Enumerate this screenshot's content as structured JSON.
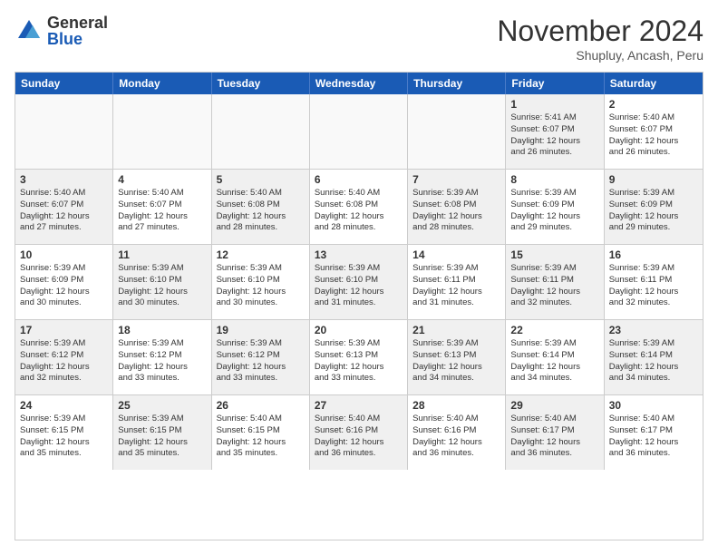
{
  "logo": {
    "general": "General",
    "blue": "Blue"
  },
  "title": "November 2024",
  "location": "Shupluy, Ancash, Peru",
  "days_of_week": [
    "Sunday",
    "Monday",
    "Tuesday",
    "Wednesday",
    "Thursday",
    "Friday",
    "Saturday"
  ],
  "rows": [
    {
      "cells": [
        {
          "day": "",
          "info": "",
          "empty": true
        },
        {
          "day": "",
          "info": "",
          "empty": true
        },
        {
          "day": "",
          "info": "",
          "empty": true
        },
        {
          "day": "",
          "info": "",
          "empty": true
        },
        {
          "day": "",
          "info": "",
          "empty": true
        },
        {
          "day": "1",
          "info": "Sunrise: 5:41 AM\nSunset: 6:07 PM\nDaylight: 12 hours\nand 26 minutes.",
          "shaded": true
        },
        {
          "day": "2",
          "info": "Sunrise: 5:40 AM\nSunset: 6:07 PM\nDaylight: 12 hours\nand 26 minutes.",
          "shaded": false
        }
      ]
    },
    {
      "cells": [
        {
          "day": "3",
          "info": "Sunrise: 5:40 AM\nSunset: 6:07 PM\nDaylight: 12 hours\nand 27 minutes.",
          "shaded": true
        },
        {
          "day": "4",
          "info": "Sunrise: 5:40 AM\nSunset: 6:07 PM\nDaylight: 12 hours\nand 27 minutes.",
          "shaded": false
        },
        {
          "day": "5",
          "info": "Sunrise: 5:40 AM\nSunset: 6:08 PM\nDaylight: 12 hours\nand 28 minutes.",
          "shaded": true
        },
        {
          "day": "6",
          "info": "Sunrise: 5:40 AM\nSunset: 6:08 PM\nDaylight: 12 hours\nand 28 minutes.",
          "shaded": false
        },
        {
          "day": "7",
          "info": "Sunrise: 5:39 AM\nSunset: 6:08 PM\nDaylight: 12 hours\nand 28 minutes.",
          "shaded": true
        },
        {
          "day": "8",
          "info": "Sunrise: 5:39 AM\nSunset: 6:09 PM\nDaylight: 12 hours\nand 29 minutes.",
          "shaded": false
        },
        {
          "day": "9",
          "info": "Sunrise: 5:39 AM\nSunset: 6:09 PM\nDaylight: 12 hours\nand 29 minutes.",
          "shaded": true
        }
      ]
    },
    {
      "cells": [
        {
          "day": "10",
          "info": "Sunrise: 5:39 AM\nSunset: 6:09 PM\nDaylight: 12 hours\nand 30 minutes.",
          "shaded": false
        },
        {
          "day": "11",
          "info": "Sunrise: 5:39 AM\nSunset: 6:10 PM\nDaylight: 12 hours\nand 30 minutes.",
          "shaded": true
        },
        {
          "day": "12",
          "info": "Sunrise: 5:39 AM\nSunset: 6:10 PM\nDaylight: 12 hours\nand 30 minutes.",
          "shaded": false
        },
        {
          "day": "13",
          "info": "Sunrise: 5:39 AM\nSunset: 6:10 PM\nDaylight: 12 hours\nand 31 minutes.",
          "shaded": true
        },
        {
          "day": "14",
          "info": "Sunrise: 5:39 AM\nSunset: 6:11 PM\nDaylight: 12 hours\nand 31 minutes.",
          "shaded": false
        },
        {
          "day": "15",
          "info": "Sunrise: 5:39 AM\nSunset: 6:11 PM\nDaylight: 12 hours\nand 32 minutes.",
          "shaded": true
        },
        {
          "day": "16",
          "info": "Sunrise: 5:39 AM\nSunset: 6:11 PM\nDaylight: 12 hours\nand 32 minutes.",
          "shaded": false
        }
      ]
    },
    {
      "cells": [
        {
          "day": "17",
          "info": "Sunrise: 5:39 AM\nSunset: 6:12 PM\nDaylight: 12 hours\nand 32 minutes.",
          "shaded": true
        },
        {
          "day": "18",
          "info": "Sunrise: 5:39 AM\nSunset: 6:12 PM\nDaylight: 12 hours\nand 33 minutes.",
          "shaded": false
        },
        {
          "day": "19",
          "info": "Sunrise: 5:39 AM\nSunset: 6:12 PM\nDaylight: 12 hours\nand 33 minutes.",
          "shaded": true
        },
        {
          "day": "20",
          "info": "Sunrise: 5:39 AM\nSunset: 6:13 PM\nDaylight: 12 hours\nand 33 minutes.",
          "shaded": false
        },
        {
          "day": "21",
          "info": "Sunrise: 5:39 AM\nSunset: 6:13 PM\nDaylight: 12 hours\nand 34 minutes.",
          "shaded": true
        },
        {
          "day": "22",
          "info": "Sunrise: 5:39 AM\nSunset: 6:14 PM\nDaylight: 12 hours\nand 34 minutes.",
          "shaded": false
        },
        {
          "day": "23",
          "info": "Sunrise: 5:39 AM\nSunset: 6:14 PM\nDaylight: 12 hours\nand 34 minutes.",
          "shaded": true
        }
      ]
    },
    {
      "cells": [
        {
          "day": "24",
          "info": "Sunrise: 5:39 AM\nSunset: 6:15 PM\nDaylight: 12 hours\nand 35 minutes.",
          "shaded": false
        },
        {
          "day": "25",
          "info": "Sunrise: 5:39 AM\nSunset: 6:15 PM\nDaylight: 12 hours\nand 35 minutes.",
          "shaded": true
        },
        {
          "day": "26",
          "info": "Sunrise: 5:40 AM\nSunset: 6:15 PM\nDaylight: 12 hours\nand 35 minutes.",
          "shaded": false
        },
        {
          "day": "27",
          "info": "Sunrise: 5:40 AM\nSunset: 6:16 PM\nDaylight: 12 hours\nand 36 minutes.",
          "shaded": true
        },
        {
          "day": "28",
          "info": "Sunrise: 5:40 AM\nSunset: 6:16 PM\nDaylight: 12 hours\nand 36 minutes.",
          "shaded": false
        },
        {
          "day": "29",
          "info": "Sunrise: 5:40 AM\nSunset: 6:17 PM\nDaylight: 12 hours\nand 36 minutes.",
          "shaded": true
        },
        {
          "day": "30",
          "info": "Sunrise: 5:40 AM\nSunset: 6:17 PM\nDaylight: 12 hours\nand 36 minutes.",
          "shaded": false
        }
      ]
    }
  ]
}
